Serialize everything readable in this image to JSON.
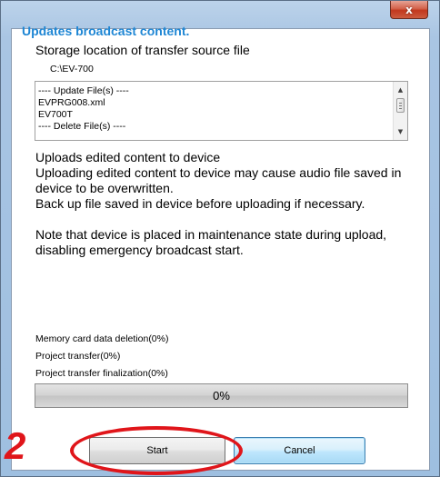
{
  "window": {
    "close_label": "x"
  },
  "dialog": {
    "headline": "Updates broadcast content.",
    "storage_label": "Storage location of transfer source file",
    "storage_path": "C:\\EV-700",
    "file_list": [
      "---- Update File(s) ----",
      "EVPRG008.xml",
      "EV700T",
      "---- Delete File(s) ----"
    ],
    "description": [
      "Uploads edited content to device",
      "Uploading edited content to device may cause audio file saved in device to be overwritten.",
      "Back up file saved in device before uploading if necessary."
    ],
    "note": "Note that device is placed in maintenance state during upload, disabling emergency broadcast start.",
    "progress_items": [
      "Memory card data deletion(0%)",
      "Project transfer(0%)",
      "Project transfer finalization(0%)"
    ],
    "progress": {
      "value": 0,
      "label": "0%"
    },
    "start_label": "Start",
    "cancel_label": "Cancel"
  },
  "annotation": {
    "step_number": "2",
    "color": "#e0151a"
  },
  "colors": {
    "headline": "#1e86d4",
    "title_bar": "#a9c5e3",
    "close_button": "#c2381e"
  },
  "icons": {
    "close": "close-icon",
    "scroll_up": "arrow-up-icon",
    "scroll_down": "arrow-down-icon"
  }
}
